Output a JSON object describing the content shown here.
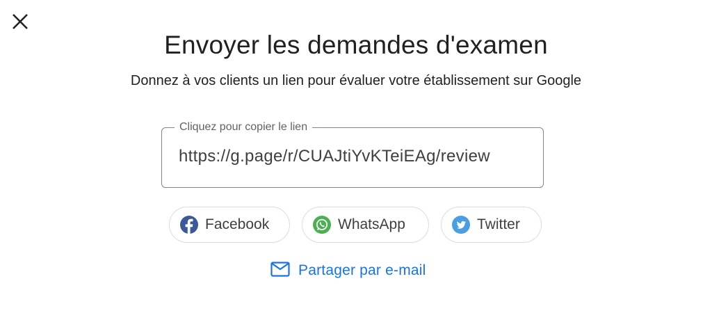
{
  "dialog": {
    "title": "Envoyer les demandes d'examen",
    "subtitle": "Donnez à vos clients un lien pour évaluer votre établissement sur Google"
  },
  "link_field": {
    "label": "Cliquez pour copier le lien",
    "value": "https://g.page/r/CUAJtiYvKTeiEAg/review"
  },
  "share_buttons": [
    {
      "label": "Facebook",
      "icon": "facebook-icon",
      "color": "#3b5998"
    },
    {
      "label": "WhatsApp",
      "icon": "whatsapp-icon",
      "color": "#4caf50"
    },
    {
      "label": "Twitter",
      "icon": "twitter-icon",
      "color": "#4a9fe0"
    }
  ],
  "email_share": {
    "label": "Partager par e-mail",
    "icon": "mail-icon",
    "color": "#1a73e8"
  },
  "icons": {
    "close": "close-icon"
  }
}
